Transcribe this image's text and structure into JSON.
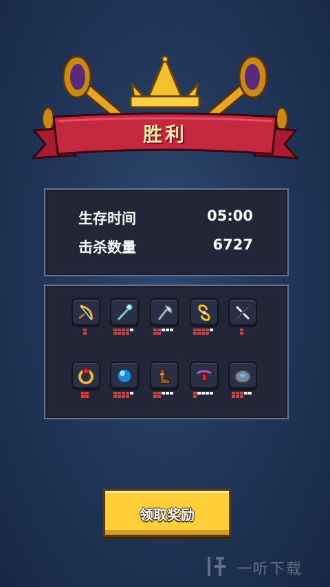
{
  "banner": {
    "title": "胜利"
  },
  "stats": {
    "survival_label": "生存时间",
    "survival_value": "05:00",
    "kills_label": "击杀数量",
    "kills_value": "6727"
  },
  "items": [
    {
      "name": "bow-icon",
      "filled": 1,
      "total": 1,
      "fill_color": "#e23a2e"
    },
    {
      "name": "magic-wand-icon",
      "filled": 4,
      "total": 5,
      "fill_color": "#e23a2e"
    },
    {
      "name": "axe-icon",
      "filled": 2,
      "total": 5,
      "fill_color": "#e23a2e"
    },
    {
      "name": "whirlwind-icon",
      "filled": 4,
      "total": 5,
      "fill_color": "#e23a2e"
    },
    {
      "name": "crossed-swords-icon",
      "filled": 1,
      "total": 1,
      "fill_color": "#e23a2e"
    },
    {
      "name": "ring-icon",
      "filled": 2,
      "total": 2,
      "fill_color": "#e23a2e"
    },
    {
      "name": "orb-icon",
      "filled": 4,
      "total": 5,
      "fill_color": "#e23a2e"
    },
    {
      "name": "boots-icon",
      "filled": 2,
      "total": 5,
      "fill_color": "#e23a2e"
    },
    {
      "name": "amulet-icon",
      "filled": 1,
      "total": 5,
      "fill_color": "#e23a2e"
    },
    {
      "name": "stone-icon",
      "filled": 3,
      "total": 5,
      "fill_color": "#e23a2e"
    }
  ],
  "claim_button": {
    "label": "领取奖励"
  },
  "watermark": {
    "text": "一听下载"
  },
  "colors": {
    "ribbon": "#c5283e",
    "gold": "#f4c12c",
    "panel_border": "#6a6f98",
    "button": "#ffcf3a"
  }
}
